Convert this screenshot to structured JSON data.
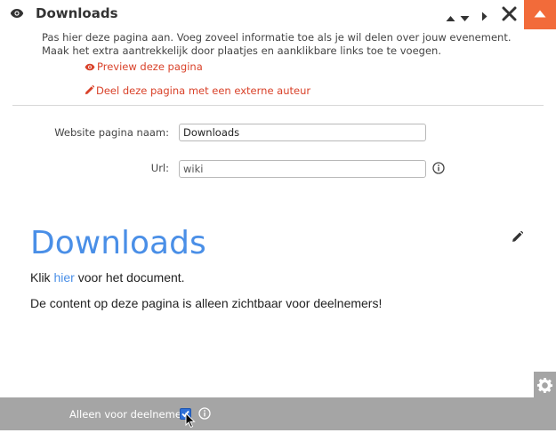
{
  "header": {
    "title": "Downloads"
  },
  "intro": {
    "text": "Pas hier deze pagina aan. Voeg zoveel informatie toe als je wil delen over jouw evenement. Maak het extra aantrekkelijk door plaatjes en aanklikbare links toe te voegen.",
    "preview_link": "Preview deze pagina",
    "share_link": "Deel deze pagina met een externe auteur"
  },
  "form": {
    "name_label": "Website pagina naam:",
    "name_value": "Downloads",
    "url_label": "Url:",
    "url_value": "wiki"
  },
  "content": {
    "heading": "Downloads",
    "para1_before": "Klik ",
    "para1_link": "hier",
    "para1_after": " voor het document.",
    "para2": "De content op deze pagina is alleen zichtbaar voor deelnemers!"
  },
  "footer": {
    "members_only_label": "Alleen voor deelnemers",
    "members_only_checked": true
  },
  "icons": {
    "header_eye": "eye-icon",
    "preview_eye": "eye-icon",
    "share_pencil": "pencil-icon",
    "close": "close-icon",
    "collapse": "caret-up-icon",
    "edit": "pencil-icon",
    "settings": "gear-icon",
    "info": "info-icon"
  },
  "colors": {
    "accent_orange": "#f26b3a",
    "link_red": "#d9422a",
    "heading_blue": "#4a8fe7",
    "footer_gray": "#a5a5a5",
    "checkbox_blue": "#2f6fd6"
  }
}
